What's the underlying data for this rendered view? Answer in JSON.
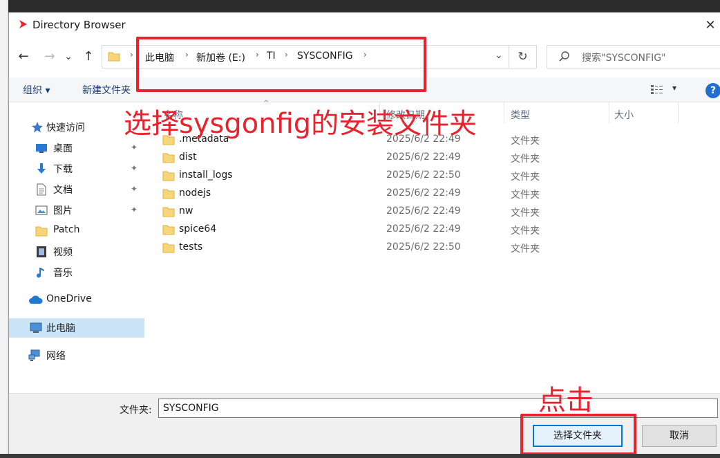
{
  "window": {
    "title": "Directory Browser",
    "close_glyph": "✕"
  },
  "nav": {
    "back_glyph": "←",
    "forward_glyph": "→",
    "recent_glyph": "⌄",
    "up_glyph": "↑",
    "breadcrumbs": [
      "此电脑",
      "新加卷 (E:)",
      "TI",
      "SYSCONFIG"
    ],
    "sep_glyph": "›",
    "dropdown_glyph": "⌄",
    "refresh_glyph": "↻"
  },
  "search": {
    "placeholder": "搜索\"SYSCONFIG\""
  },
  "toolbar": {
    "organize": "组织 ▾",
    "new_folder": "新建文件夹",
    "view_dd": "▾",
    "help": "?"
  },
  "annotations": {
    "main": "选择sysgonfig的安装文件夹",
    "click": "点击"
  },
  "sidebar": {
    "quick_access": "快速访问",
    "items": [
      {
        "label": "桌面",
        "icon": "desktop-icon",
        "pinned": true
      },
      {
        "label": "下载",
        "icon": "download-icon",
        "pinned": true
      },
      {
        "label": "文档",
        "icon": "document-icon",
        "pinned": true
      },
      {
        "label": "图片",
        "icon": "picture-icon",
        "pinned": true
      },
      {
        "label": "Patch",
        "icon": "folder-icon",
        "pinned": false
      },
      {
        "label": "视频",
        "icon": "video-icon",
        "pinned": false
      },
      {
        "label": "音乐",
        "icon": "music-icon",
        "pinned": false
      }
    ],
    "onedrive": "OneDrive",
    "this_pc": "此电脑",
    "network": "网络",
    "pin_glyph": "📌"
  },
  "columns": {
    "name": "名称",
    "date": "修改日期",
    "type": "类型",
    "size": "大小",
    "sort_glyph": "^"
  },
  "files": [
    {
      "name": ".metadata",
      "date": "2025/6/2 22:49",
      "type": "文件夹"
    },
    {
      "name": "dist",
      "date": "2025/6/2 22:49",
      "type": "文件夹"
    },
    {
      "name": "install_logs",
      "date": "2025/6/2 22:50",
      "type": "文件夹"
    },
    {
      "name": "nodejs",
      "date": "2025/6/2 22:49",
      "type": "文件夹"
    },
    {
      "name": "nw",
      "date": "2025/6/2 22:49",
      "type": "文件夹"
    },
    {
      "name": "spice64",
      "date": "2025/6/2 22:49",
      "type": "文件夹"
    },
    {
      "name": "tests",
      "date": "2025/6/2 22:50",
      "type": "文件夹"
    }
  ],
  "footer": {
    "folder_label": "文件夹:",
    "folder_value": "SYSCONFIG",
    "select_button": "选择文件夹",
    "cancel_button": "取消"
  }
}
